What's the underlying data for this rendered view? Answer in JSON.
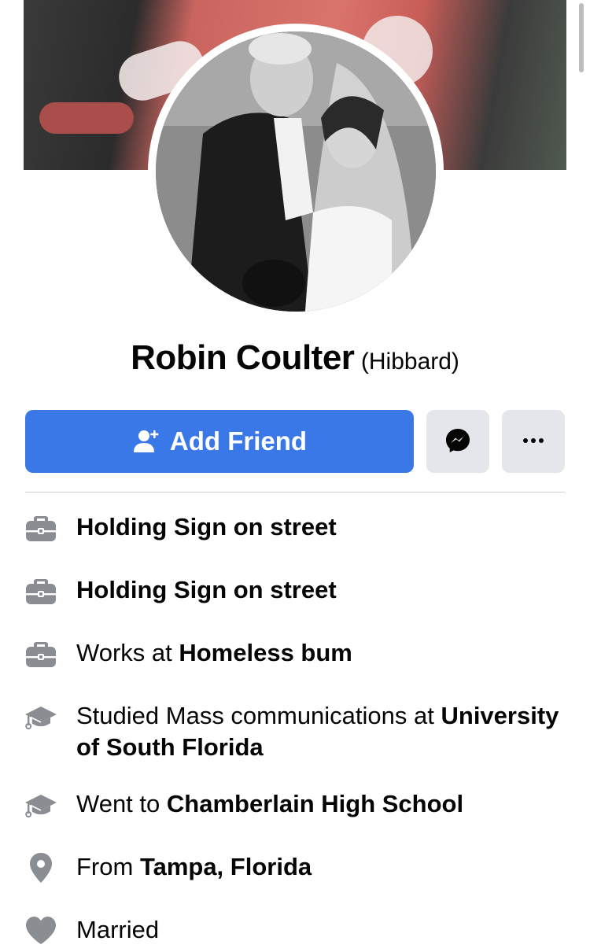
{
  "profile": {
    "name": "Robin Coulter",
    "alternate_name": "(Hibbard)"
  },
  "actions": {
    "add_friend_label": "Add Friend",
    "messenger_icon": "messenger-icon",
    "more_icon": "more-dots-icon"
  },
  "details": [
    {
      "icon": "briefcase-icon",
      "prefix": "",
      "bold": "Holding Sign on street"
    },
    {
      "icon": "briefcase-icon",
      "prefix": "",
      "bold": "Holding Sign on street"
    },
    {
      "icon": "briefcase-icon",
      "prefix": "Works at ",
      "bold": "Homeless bum"
    },
    {
      "icon": "graduation-cap-icon",
      "prefix": "Studied Mass communications at ",
      "bold": "University of South Florida"
    },
    {
      "icon": "graduation-cap-icon",
      "prefix": "Went to ",
      "bold": "Chamberlain High School"
    },
    {
      "icon": "location-pin-icon",
      "prefix": "From ",
      "bold": "Tampa, Florida"
    },
    {
      "icon": "heart-icon",
      "prefix": "",
      "bold": "",
      "plain": "Married"
    }
  ],
  "colors": {
    "primary_button": "#3b78e7",
    "secondary_button": "#e4e6eb",
    "icon_gray": "#8a8d91"
  }
}
